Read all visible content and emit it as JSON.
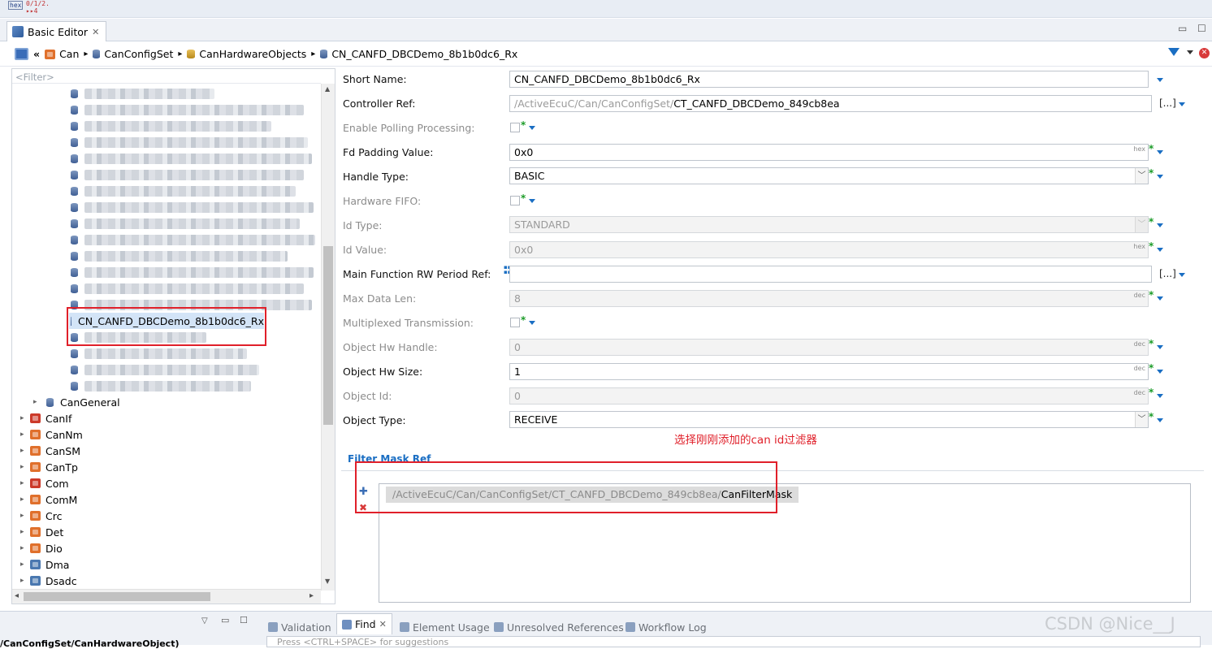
{
  "topbar": {
    "icon1_text": "hex",
    "icon2_text": "0/1/2/...\n▸▸4"
  },
  "editor_tab": {
    "label": "Basic Editor",
    "close": "✕"
  },
  "window_controls": {
    "minimize": "▭",
    "maximize": "☐"
  },
  "breadcrumb": {
    "items": [
      "Can",
      "CanConfigSet",
      "CanHardwareObjects",
      "CN_CANFD_DBCDemo_8b1b0dc6_Rx"
    ],
    "back": "«",
    "separator": "▸"
  },
  "tree": {
    "filter_placeholder": "<Filter>",
    "selected_item": "CN_CANFD_DBCDemo_8b1b0dc6_Rx",
    "can_general": "CanGeneral",
    "modules": [
      "CanIf",
      "CanNm",
      "CanSM",
      "CanTp",
      "Com",
      "ComM",
      "Crc",
      "Det",
      "Dio",
      "Dma",
      "Dsadc"
    ],
    "module_colors": [
      "#cc3a2a",
      "#e0702c",
      "#e0702c",
      "#e0702c",
      "#cc3a2a",
      "#e0702c",
      "#e0702c",
      "#e0702c",
      "#e0702c",
      "#4a78b0",
      "#4a78b0"
    ]
  },
  "form": {
    "short_name": {
      "label": "Short Name:",
      "value": "CN_CANFD_DBCDemo_8b1b0dc6_Rx"
    },
    "controller_ref": {
      "label": "Controller Ref:",
      "prefix": "/ActiveEcuC/Can/CanConfigSet/",
      "value": "CT_CANFD_DBCDemo_849cb8ea",
      "browse": "[...]"
    },
    "enable_polling": {
      "label": "Enable Polling Processing:"
    },
    "fd_padding": {
      "label": "Fd Padding Value:",
      "value": "0x0",
      "unit": "hex"
    },
    "handle_type": {
      "label": "Handle Type:",
      "value": "BASIC"
    },
    "hardware_fifo": {
      "label": "Hardware FIFO:"
    },
    "id_type": {
      "label": "Id Type:",
      "value": "STANDARD"
    },
    "id_value": {
      "label": "Id Value:",
      "value": "0x0",
      "unit": "hex"
    },
    "main_function": {
      "label": "Main Function RW Period Ref:",
      "value": "",
      "browse": "[...]"
    },
    "max_data_len": {
      "label": "Max Data Len:",
      "value": "8",
      "unit": "dec"
    },
    "multiplexed": {
      "label": "Multiplexed Transmission:"
    },
    "object_hw_handle": {
      "label": "Object Hw Handle:",
      "value": "0",
      "unit": "dec"
    },
    "object_hw_size": {
      "label": "Object Hw Size:",
      "value": "1",
      "unit": "dec"
    },
    "object_id": {
      "label": "Object Id:",
      "value": "0",
      "unit": "dec"
    },
    "object_type": {
      "label": "Object Type:",
      "value": "RECEIVE"
    }
  },
  "annotation": "选择刚刚添加的can id过滤器",
  "filter_mask": {
    "title": "Filter Mask Ref",
    "entry_prefix": "/ActiveEcuC/Can/CanConfigSet/CT_CANFD_DBCDemo_849cb8ea/",
    "entry_value": "CanFilterMask",
    "add": "✚",
    "remove": "✖"
  },
  "bottom": {
    "path_fragment": "/CanConfigSet/CanHardwareObject)",
    "tabs": [
      "Validation",
      "Find",
      "Element Usage",
      "Unresolved References",
      "Workflow Log"
    ],
    "active_tab": "Find",
    "search_hint": "Press <CTRL+SPACE> for suggestions",
    "watermark": "CSDN @Nice__J"
  },
  "colors": {
    "accent": "#1a6ec3",
    "annotation": "#e0202a",
    "selected": "#d3e4f7",
    "required": "#1c9b28"
  }
}
